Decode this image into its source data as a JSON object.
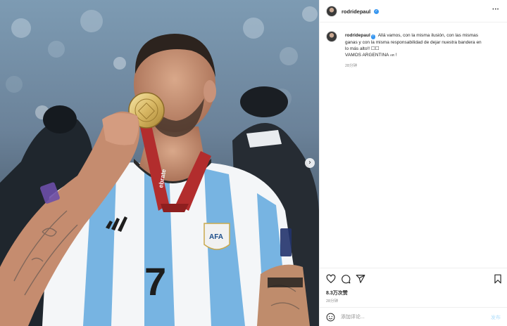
{
  "post": {
    "username": "rodridepaul",
    "caption_line1": "Allá vamos, con la misma ilusión, con las mismas",
    "caption_line2": "ganas y con la misma responsabilidad de dejar nuestra bandera en",
    "caption_line3": "lo más alto!! ☐☐",
    "caption_line4": "VAMOS ARGENTINA ",
    "caption_flag": "AR",
    "caption_end": " !",
    "caption_time": "28分钟",
    "likes": "8.3万次赞",
    "time": "28分钟"
  },
  "photo": {
    "jersey_number": "7",
    "medal_ribbon_text": "ebrate",
    "badge_text": "AFA"
  },
  "comment_box": {
    "placeholder": "添加评论...",
    "post_label": "发布"
  },
  "icons": {
    "verified": "verified-badge-icon",
    "more": "more-options-icon",
    "like": "heart-icon",
    "comment": "comment-icon",
    "share": "share-icon",
    "save": "bookmark-icon",
    "emoji": "emoji-icon",
    "next": "chevron-right-icon"
  },
  "colors": {
    "verified": "#3897f0",
    "post_button": "#b2dffc",
    "secondary_text": "#8e8e8e"
  }
}
